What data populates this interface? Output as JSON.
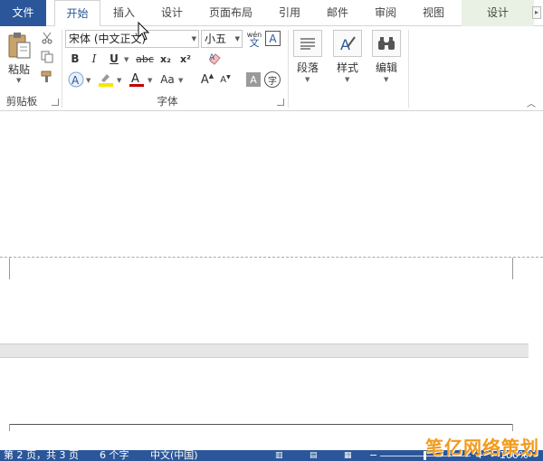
{
  "tabs": {
    "file": "文件",
    "home": "开始",
    "insert": "插入",
    "design1": "设计",
    "layout": "页面布局",
    "references": "引用",
    "mailings": "邮件",
    "review": "审阅",
    "view": "视图",
    "design2": "设计"
  },
  "clipboard": {
    "paste_label": "粘贴",
    "group_label": "剪贴板"
  },
  "font": {
    "font_name": "宋体 (中文正文)",
    "font_size": "小五",
    "wen_label": "wén",
    "wen_char": "文",
    "bordered_a": "A",
    "bold": "B",
    "italic": "I",
    "underline": "U",
    "strike": "abc",
    "subscript": "x₂",
    "superscript": "x²",
    "font_color_a": "A",
    "change_case": "Aa",
    "grow_font": "A",
    "shrink_font": "A",
    "char_shading": "A",
    "enclose_char": "字",
    "group_label": "字体"
  },
  "paragraph": {
    "label": "段落"
  },
  "styles": {
    "label": "样式"
  },
  "editing": {
    "label": "编辑"
  },
  "status": {
    "page": "第 2 页，共 3 页",
    "words": "6 个字",
    "language": "中文(中国)",
    "zoom": "100%"
  },
  "watermark": "笔亿网络策划",
  "colors": {
    "accent": "#2b579a",
    "highlight": "#f7e600",
    "font_color": "#c00000",
    "watermark": "#f29b1e"
  }
}
